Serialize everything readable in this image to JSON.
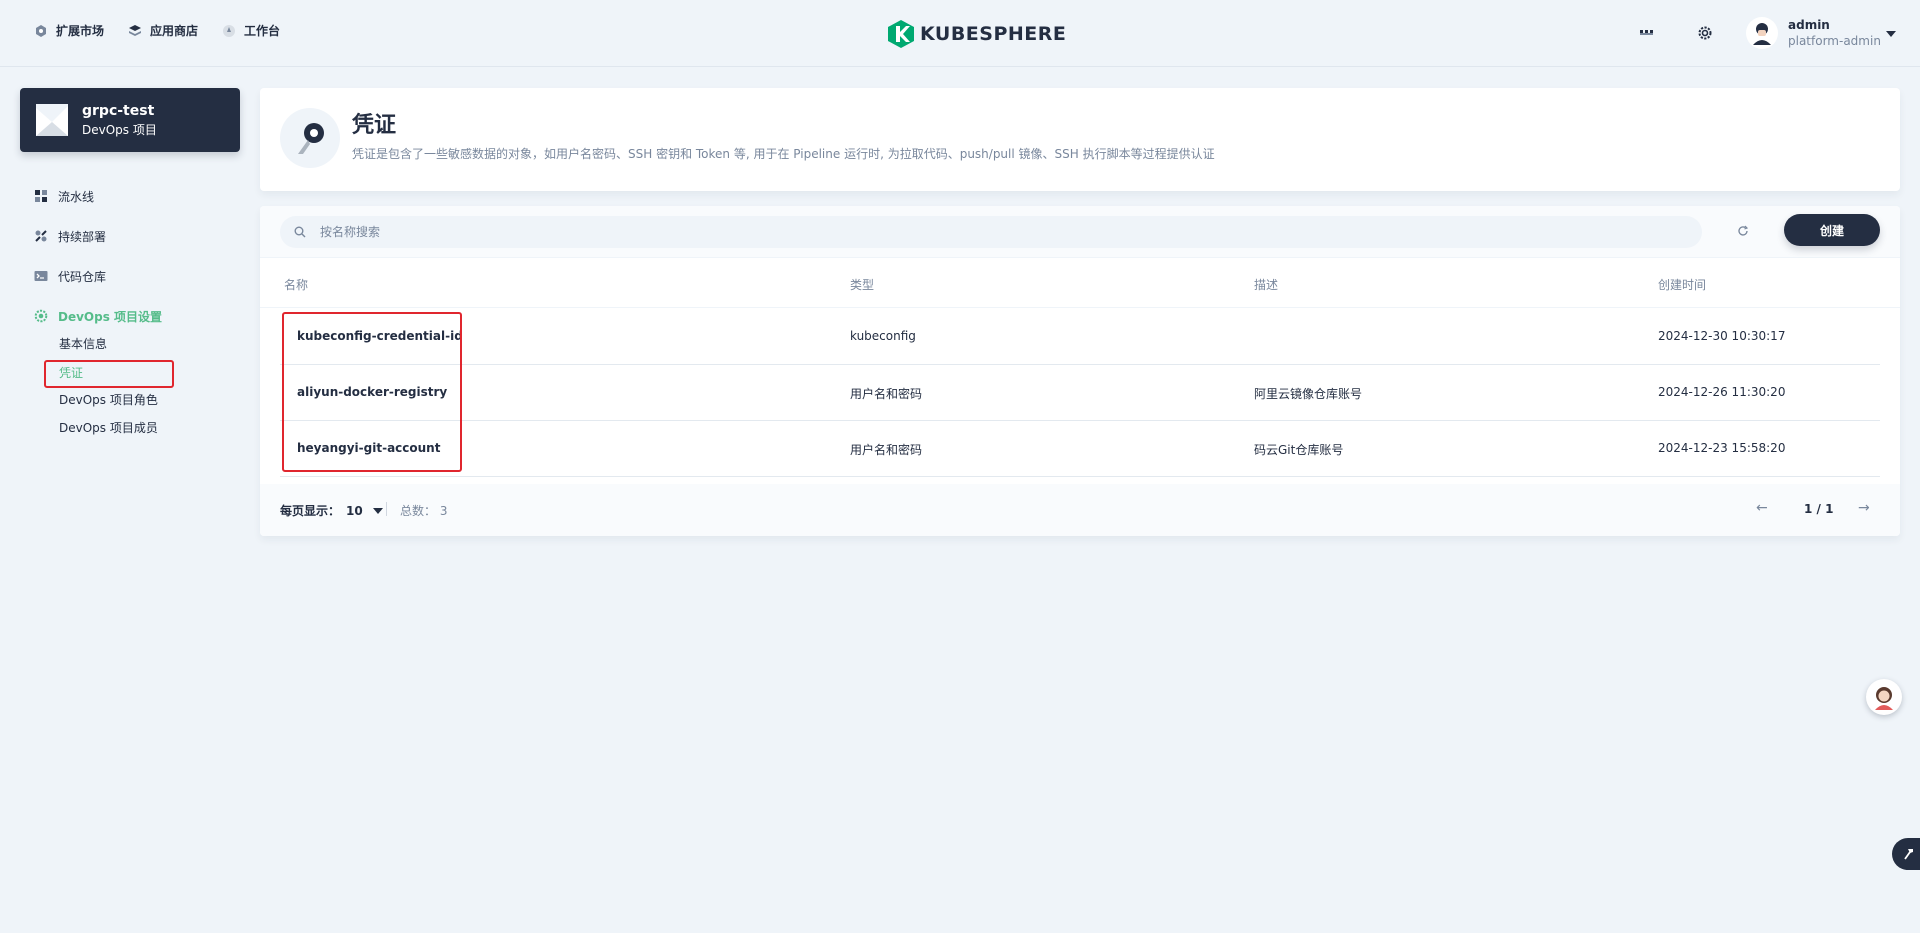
{
  "topnav": {
    "items": [
      {
        "label": "扩展市场",
        "icon": "extension-icon"
      },
      {
        "label": "应用商店",
        "icon": "app-store-icon"
      },
      {
        "label": "工作台",
        "icon": "workbench-icon"
      }
    ],
    "logo_text": "KUBESPHERE",
    "user": {
      "name": "admin",
      "role": "platform-admin"
    }
  },
  "project": {
    "name": "grpc-test",
    "type": "DevOps 项目"
  },
  "sidebar": {
    "items": [
      {
        "label": "流水线",
        "icon": "pipeline-icon"
      },
      {
        "label": "持续部署",
        "icon": "deploy-icon"
      },
      {
        "label": "代码仓库",
        "icon": "code-repo-icon"
      },
      {
        "label": "DevOps 项目设置",
        "icon": "settings-icon",
        "active": true
      }
    ],
    "subitems": [
      {
        "label": "基本信息"
      },
      {
        "label": "凭证",
        "active": true
      },
      {
        "label": "DevOps 项目角色"
      },
      {
        "label": "DevOps 项目成员"
      }
    ]
  },
  "header": {
    "title": "凭证",
    "description": "凭证是包含了一些敏感数据的对象，如用户名密码、SSH 密钥和 Token 等, 用于在 Pipeline 运行时, 为拉取代码、push/pull 镜像、SSH 执行脚本等过程提供认证"
  },
  "toolbar": {
    "search_placeholder": "按名称搜索",
    "create_label": "创建"
  },
  "table": {
    "columns": [
      "名称",
      "类型",
      "描述",
      "创建时间"
    ],
    "rows": [
      {
        "name": "kubeconfig-credential-id",
        "type": "kubeconfig",
        "desc": "",
        "time": "2024-12-30 10:30:17"
      },
      {
        "name": "aliyun-docker-registry",
        "type": "用户名和密码",
        "desc": "阿里云镜像仓库账号",
        "time": "2024-12-26 11:30:20"
      },
      {
        "name": "heyangyi-git-account",
        "type": "用户名和密码",
        "desc": "码云Git仓库账号",
        "time": "2024-12-23 15:58:20"
      }
    ]
  },
  "pager": {
    "page_size_label": "每页显示：",
    "page_size": "10",
    "total_label": "总数：",
    "total": "3",
    "page": "1 / 1",
    "prev": "←",
    "next": "→"
  },
  "colors": {
    "accent": "#55bc8a",
    "dark": "#242e42",
    "highlight": "#e0262e"
  }
}
